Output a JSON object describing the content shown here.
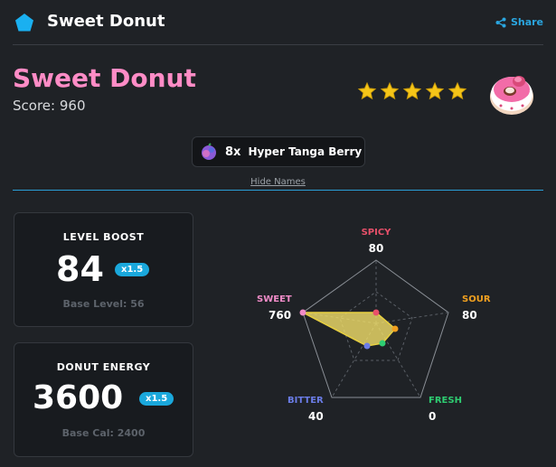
{
  "header": {
    "app_title": "Sweet Donut",
    "share_label": "Share"
  },
  "main": {
    "title": "Sweet Donut",
    "score_label": "Score:",
    "score_value": "960",
    "rating_stars": 5,
    "ingredient": {
      "quantity": "8x",
      "name": "Hyper Tanga Berry"
    },
    "hide_names_label": "Hide Names"
  },
  "cards": {
    "level": {
      "title": "LEVEL BOOST",
      "value": "84",
      "multiplier": "x1.5",
      "base_label": "Base Level: 56"
    },
    "energy": {
      "title": "DONUT ENERGY",
      "value": "3600",
      "multiplier": "x1.5",
      "base_label": "Base Cal: 2400"
    }
  },
  "flavors": {
    "spicy": {
      "label": "SPICY",
      "value": "80"
    },
    "sour": {
      "label": "SOUR",
      "value": "80"
    },
    "fresh": {
      "label": "FRESH",
      "value": "0"
    },
    "bitter": {
      "label": "BITTER",
      "value": "40"
    },
    "sweet": {
      "label": "SWEET",
      "value": "760"
    }
  },
  "colors": {
    "title_pink": "#ff8cc6",
    "accent_blue": "#2aa6e0",
    "spicy": "#e8506a",
    "sour": "#f0a020",
    "fresh": "#2ecc71",
    "bitter": "#6b7de8",
    "sweet": "#f08cc8",
    "radar_fill": "#f2e06a"
  }
}
